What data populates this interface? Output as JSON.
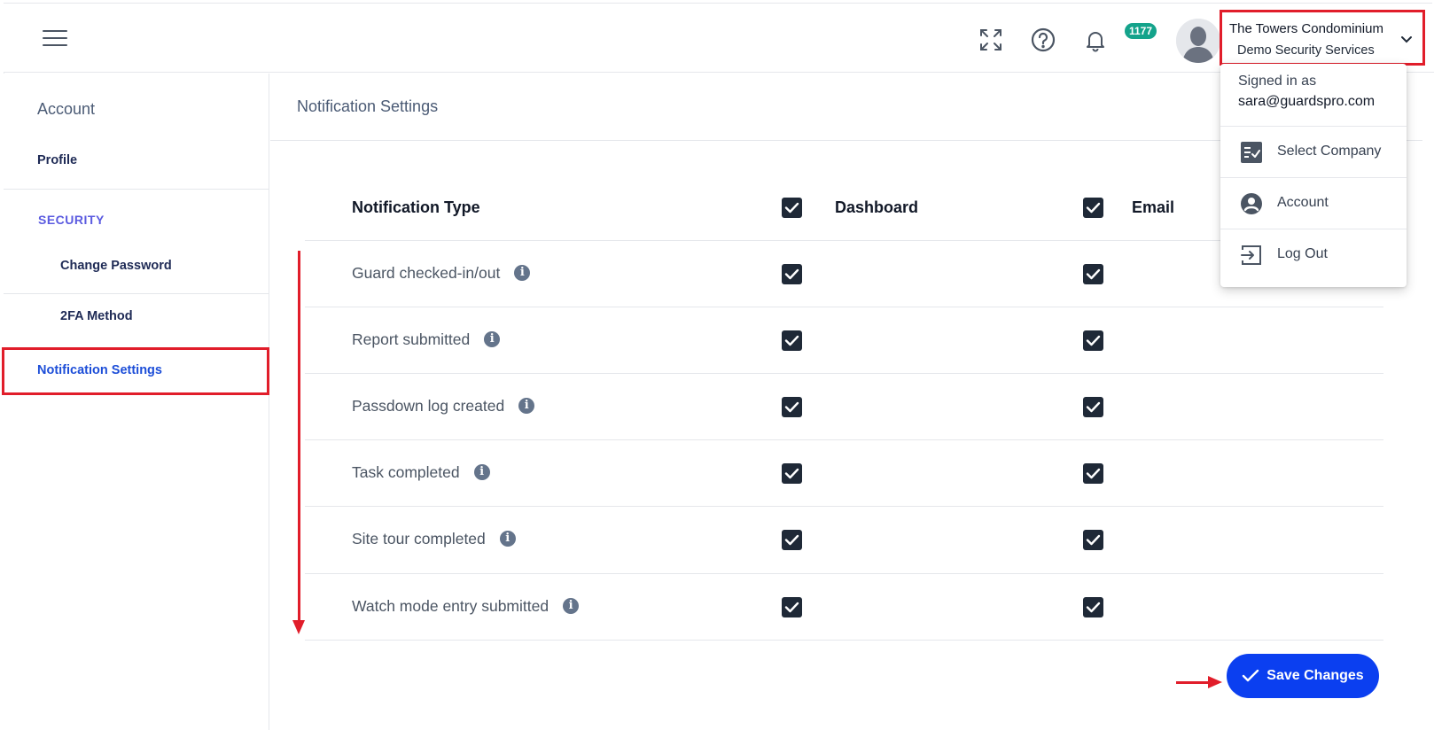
{
  "header": {
    "menu_icon": "hamburger-icon",
    "fullscreen_icon": "expand-icon",
    "help_icon": "help-circle-icon",
    "bell_icon": "bell-icon",
    "notification_count": "1177",
    "company_name": "The Towers Condominium",
    "company_sub": "Demo Security Services"
  },
  "sidebar": {
    "account_heading": "Account",
    "profile": "Profile",
    "security_heading": "SECURITY",
    "change_password": "Change Password",
    "twofa": "2FA Method",
    "notification_settings": "Notification Settings"
  },
  "main": {
    "title": "Notification Settings",
    "columns": {
      "type": "Notification Type",
      "dashboard": "Dashboard",
      "email": "Email"
    },
    "rows": [
      {
        "label": "Guard checked-in/out",
        "dashboard": true,
        "email": true
      },
      {
        "label": "Report submitted",
        "dashboard": true,
        "email": true
      },
      {
        "label": "Passdown log created",
        "dashboard": true,
        "email": true
      },
      {
        "label": "Task completed",
        "dashboard": true,
        "email": true
      },
      {
        "label": "Site tour completed",
        "dashboard": true,
        "email": true
      },
      {
        "label": "Watch mode entry submitted",
        "dashboard": true,
        "email": true
      }
    ],
    "save_label": "Save Changes"
  },
  "dropdown": {
    "signed_in_as": "Signed in as",
    "email": "sara@guardspro.com",
    "items": [
      {
        "label": "Select Company",
        "icon": "checklist-icon"
      },
      {
        "label": "Account",
        "icon": "account-circle-icon"
      },
      {
        "label": "Log Out",
        "icon": "logout-icon"
      }
    ]
  },
  "colors": {
    "accent": "#0b3ff0",
    "badge": "#14a38b",
    "highlight": "#e11d2a",
    "checkbox": "#1f2937"
  }
}
